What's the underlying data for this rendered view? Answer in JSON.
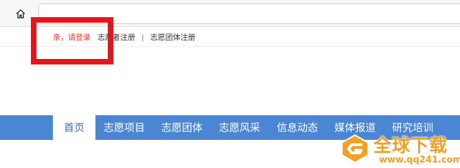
{
  "browser": {
    "home_icon": "home-icon"
  },
  "topbar": {
    "login_link": "亲，请登录",
    "volunteer_register": "志愿者注册",
    "separator": "|",
    "group_register": "志愿团体注册"
  },
  "nav": {
    "items": [
      {
        "label": "首页",
        "active": true
      },
      {
        "label": "志愿项目"
      },
      {
        "label": "志愿团体"
      },
      {
        "label": "志愿风采"
      },
      {
        "label": "信息动态"
      },
      {
        "label": "媒体报道"
      },
      {
        "label": "研究培训"
      }
    ],
    "bar_color": "#4a86d4",
    "active_text_color": "#2e6fc2"
  },
  "annotation": {
    "highlight_color": "#e8141c"
  },
  "watermark": {
    "text": "全球下载",
    "url": "www.qq241.com",
    "color": "#f4a023"
  }
}
